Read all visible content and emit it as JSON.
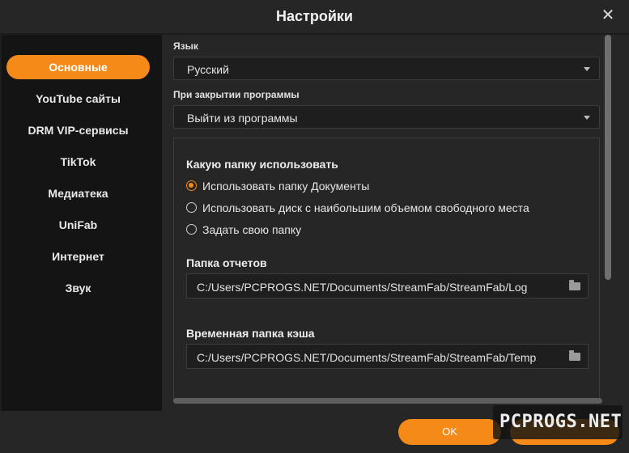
{
  "window": {
    "title": "Настройки"
  },
  "sidebar": {
    "items": [
      {
        "label": "Основные"
      },
      {
        "label": "YouTube сайты"
      },
      {
        "label": "DRM VIP-сервисы"
      },
      {
        "label": "TikTok"
      },
      {
        "label": "Медиатека"
      },
      {
        "label": "UniFab"
      },
      {
        "label": "Интернет"
      },
      {
        "label": "Звук"
      }
    ],
    "active_item": "Основные"
  },
  "general": {
    "language": {
      "label": "Язык",
      "value": "Русский"
    },
    "on_close": {
      "label": "При закрытии программы",
      "value": "Выйти из программы"
    },
    "folder_choice": {
      "heading": "Какую папку использовать",
      "options": [
        {
          "label": "Использовать папку Документы",
          "checked": true
        },
        {
          "label": "Использовать диск с наибольшим объемом свободного места",
          "checked": false
        },
        {
          "label": "Задать свою папку",
          "checked": false
        }
      ]
    },
    "log_folder": {
      "label": "Папка отчетов",
      "value": "C:/Users/PCPROGS.NET/Documents/StreamFab/StreamFab/Log"
    },
    "cache_folder": {
      "label": "Временная папка кэша",
      "value": "C:/Users/PCPROGS.NET/Documents/StreamFab/StreamFab/Temp"
    }
  },
  "footer": {
    "ok_label": "OK"
  },
  "watermark": {
    "text": "PCPROGS.NET"
  },
  "colors": {
    "accent": "#f58a18",
    "background": "#262626",
    "sidebar": "#141414"
  }
}
